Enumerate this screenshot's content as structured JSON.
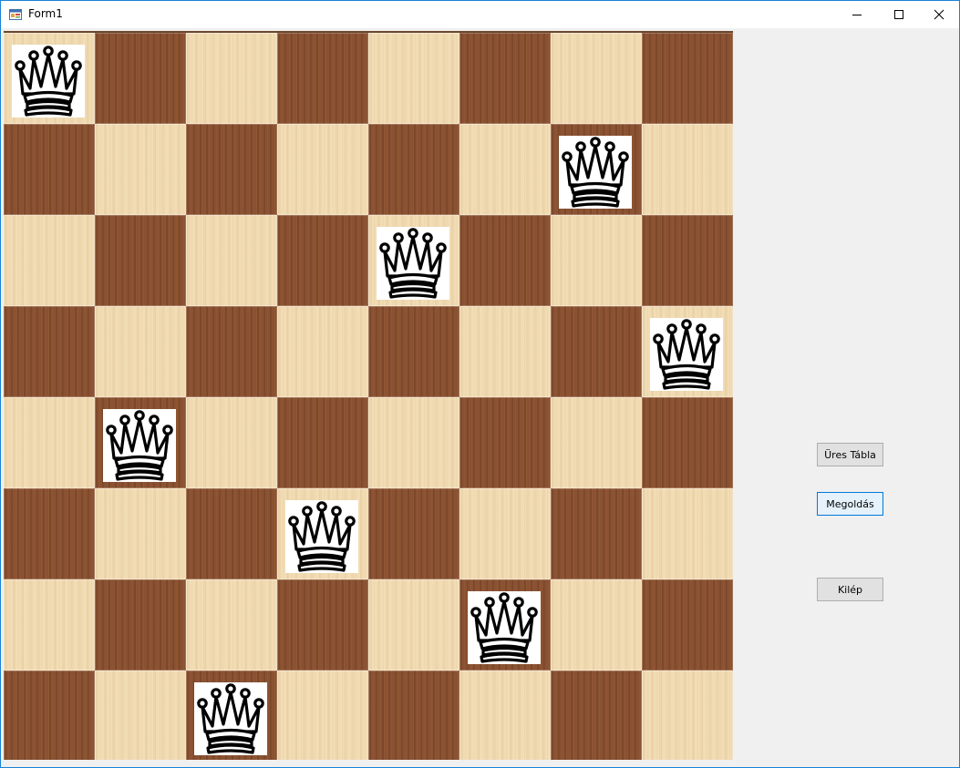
{
  "window": {
    "title": "Form1",
    "icon": "form-app-icon",
    "controls": [
      "minimize-icon",
      "maximize-icon",
      "close-icon"
    ]
  },
  "board": {
    "size": 8,
    "queen_icon": "queen-icon",
    "queens": [
      {
        "row": 0,
        "col": 0
      },
      {
        "row": 1,
        "col": 6
      },
      {
        "row": 2,
        "col": 4
      },
      {
        "row": 3,
        "col": 7
      },
      {
        "row": 4,
        "col": 1
      },
      {
        "row": 5,
        "col": 3
      },
      {
        "row": 6,
        "col": 5
      },
      {
        "row": 7,
        "col": 2
      }
    ]
  },
  "buttons": {
    "empty_board": "Üres Tábla",
    "solve": "Megoldás",
    "exit": "Kilép"
  },
  "colors": {
    "light_square": "#f2dcb4",
    "dark_square": "#8a5232",
    "window_border": "#1883d7",
    "focus_border": "#0078d7"
  }
}
